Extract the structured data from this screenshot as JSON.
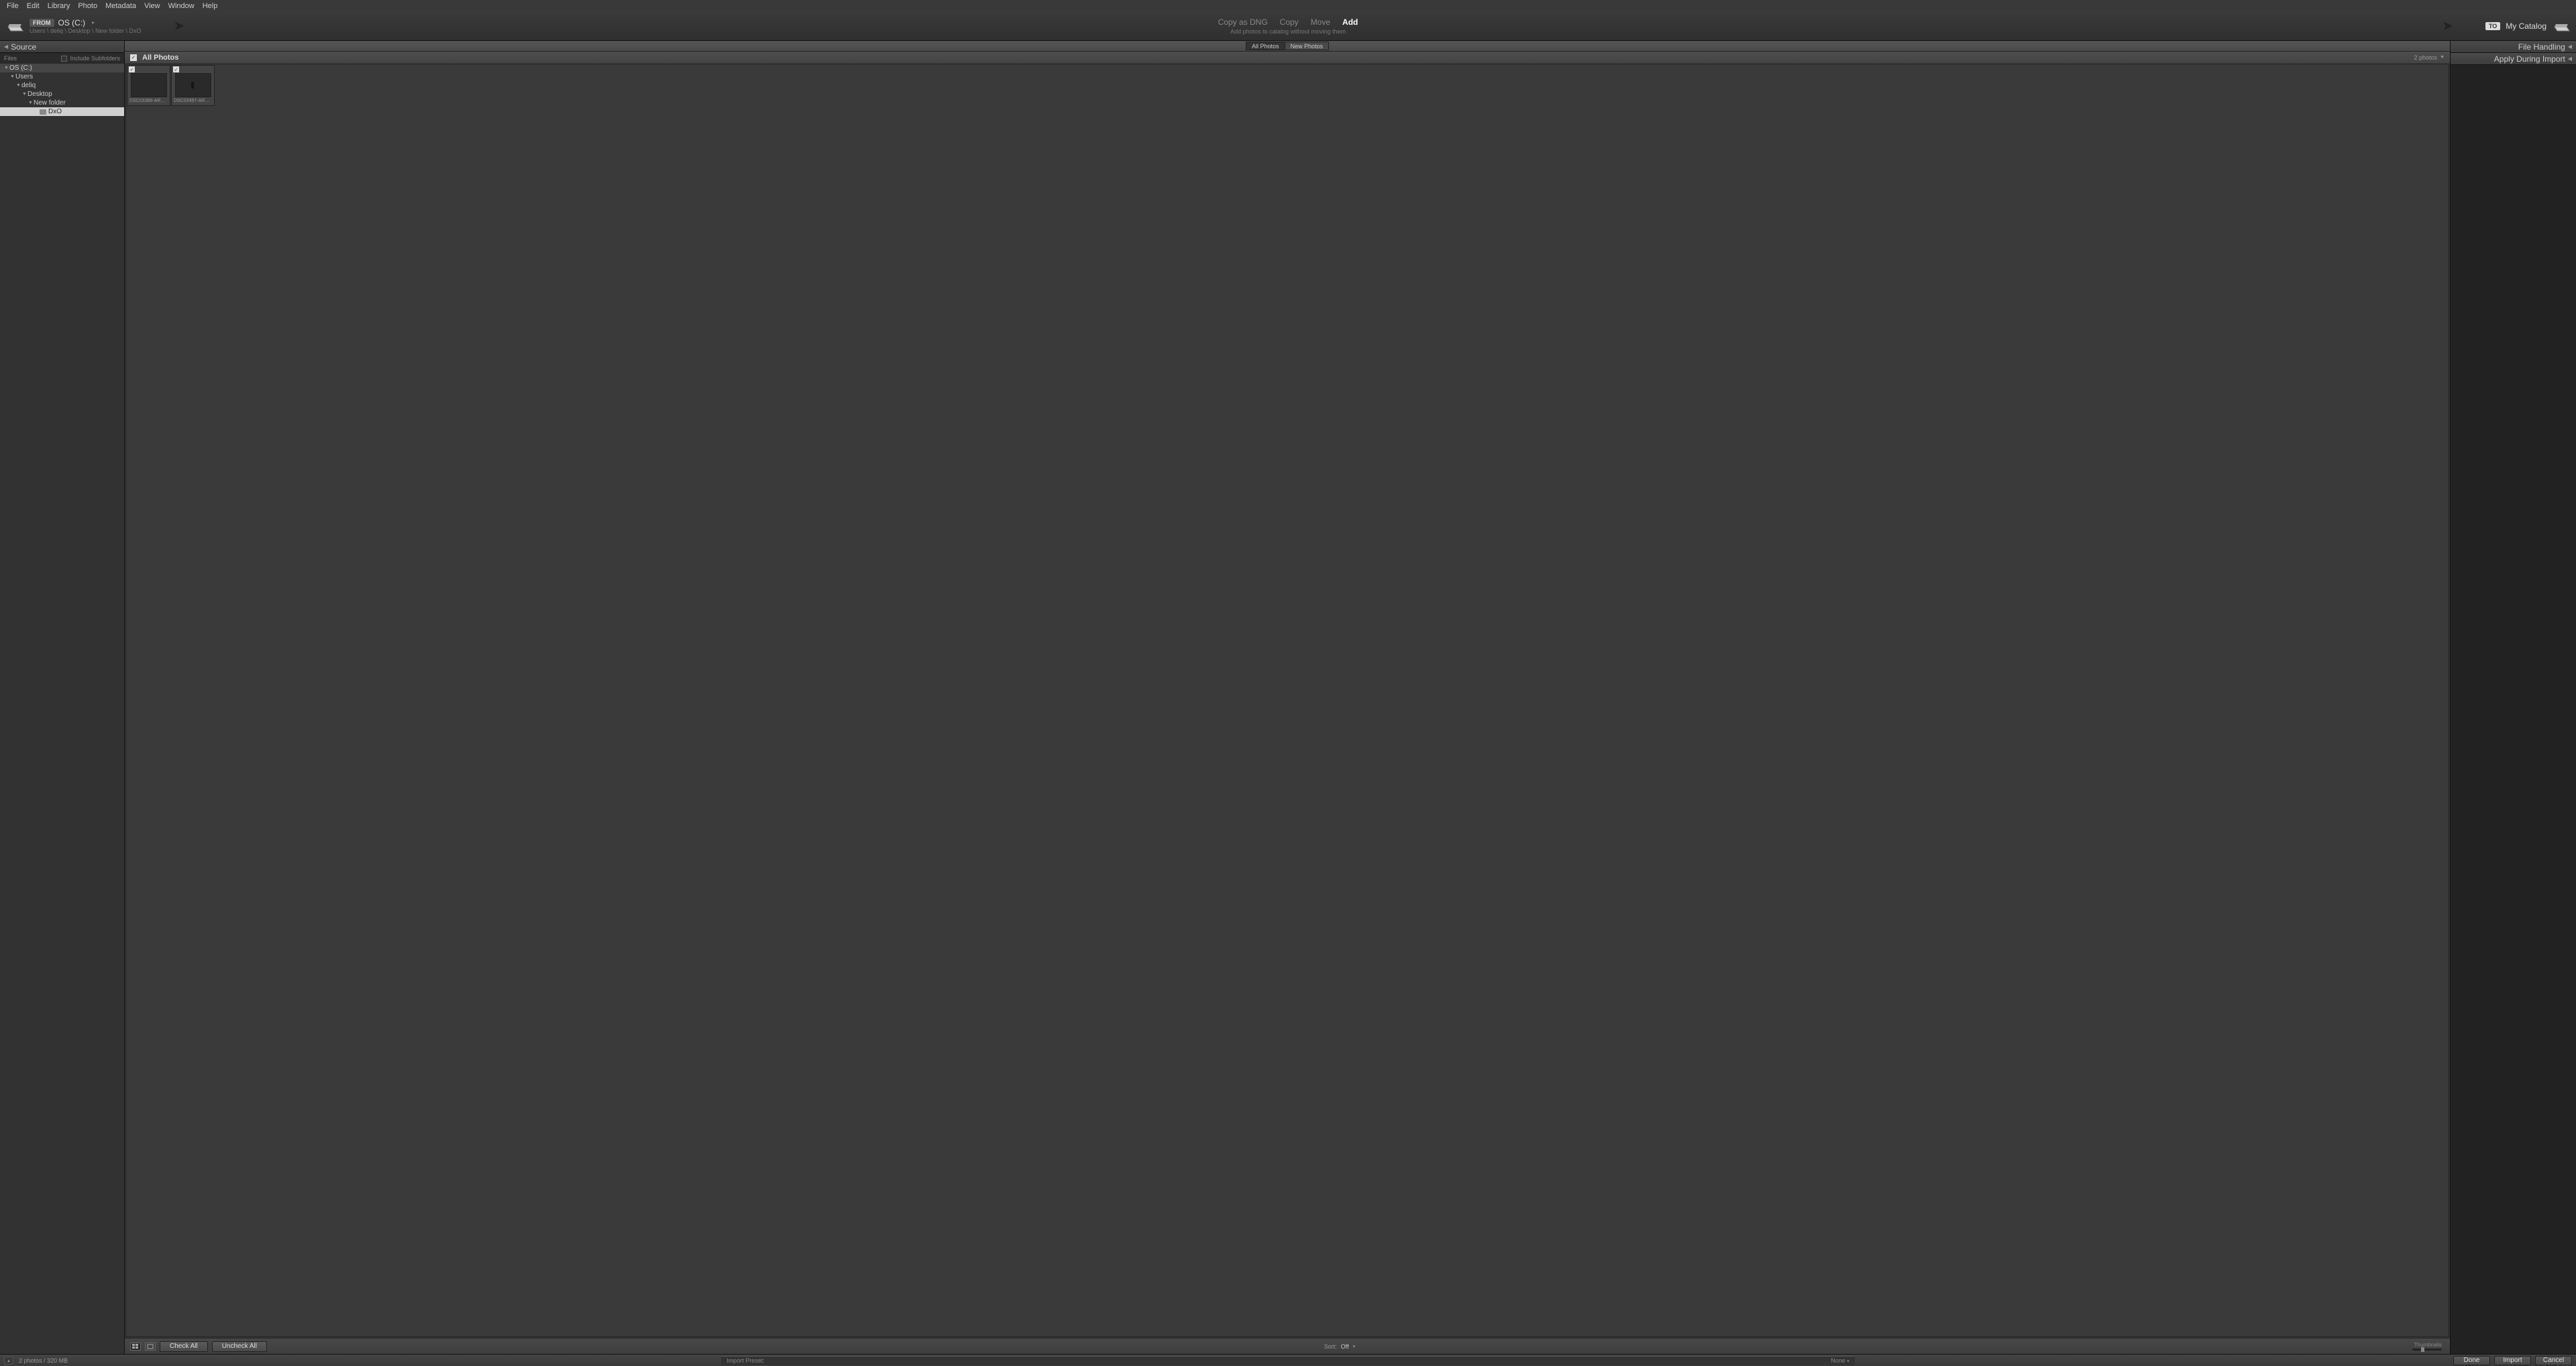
{
  "menu": [
    "File",
    "Edit",
    "Library",
    "Photo",
    "Metadata",
    "View",
    "Window",
    "Help"
  ],
  "header": {
    "from_badge": "FROM",
    "source_name": "OS (C:)",
    "source_path": "Users \\ deliq \\ Desktop \\ New folder \\ DxO",
    "actions": [
      "Copy as DNG",
      "Copy",
      "Move",
      "Add"
    ],
    "active_action": 3,
    "subtitle": "Add photos to catalog without moving them",
    "to_badge": "TO",
    "dest_name": "My Catalog"
  },
  "left": {
    "title": "Source",
    "files_label": "Files",
    "include_label": "Include Subfolders",
    "tree": [
      {
        "indent": 0,
        "label": "OS (C:)",
        "hl": true,
        "tw": "▼"
      },
      {
        "indent": 1,
        "label": "Users",
        "tw": "▼"
      },
      {
        "indent": 2,
        "label": "deliq",
        "tw": "▼"
      },
      {
        "indent": 3,
        "label": "Desktop",
        "tw": "▼"
      },
      {
        "indent": 4,
        "label": "New folder",
        "tw": "▼"
      },
      {
        "indent": 5,
        "label": "DxO",
        "sel": true,
        "icon": true
      }
    ]
  },
  "center": {
    "filters": [
      "All Photos",
      "New Photos"
    ],
    "active_filter": 0,
    "header_title": "All Photos",
    "count_label": "2 photos",
    "thumbs": [
      {
        "file": "DSC03386-ARW_DxO_...",
        "img": "a"
      },
      {
        "file": "DSC03497-ARW_DxO_...",
        "img": "b"
      }
    ],
    "check_all": "Check All",
    "uncheck_all": "Uncheck All",
    "sort_label": "Sort:",
    "sort_value": "Off",
    "thumb_label": "Thumbnails"
  },
  "right": {
    "panels": [
      "File Handling",
      "Apply During Import"
    ]
  },
  "bottom": {
    "status": "2 photos / 320 MB",
    "preset_label": "Import Preset:",
    "preset_value": "None",
    "buttons": [
      "Done",
      "Import",
      "Cancel"
    ]
  }
}
